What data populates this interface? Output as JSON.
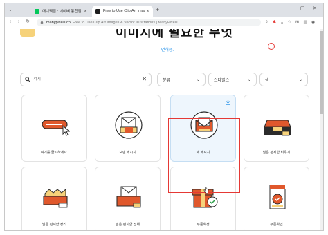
{
  "browser": {
    "tabs": [
      {
        "title": "애니팩말 : 네이버 통합검색",
        "favicon_color": "#03c75a",
        "active": false
      },
      {
        "title": "Free to Use Clip Art Images & ",
        "favicon_color": "#1d1d1d",
        "active": true
      }
    ],
    "new_tab_label": "+",
    "url_host": "manypixels.co",
    "url_rest": "Free to Use Clip Art Images & Vector Illustrations | ManyPixels"
  },
  "page": {
    "headline": "이미지에 필요한 무엇",
    "sublink": "면허증.",
    "search": {
      "placeholder": "서치",
      "value": ""
    },
    "filters": [
      {
        "label": "분류"
      },
      {
        "label": "스타일스"
      },
      {
        "label": "색"
      }
    ],
    "cards": [
      {
        "label": "여기를 클릭하세요.",
        "icon": "click-here-button-icon"
      },
      {
        "label": "보낸 메시지",
        "icon": "sent-message-icon"
      },
      {
        "label": "새 메시지",
        "icon": "new-message-icon",
        "selected": true
      },
      {
        "label": "받은 편지함 비우기",
        "icon": "empty-inbox-icon"
      },
      {
        "label": "받은 편지함 정리",
        "icon": "inbox-clean-icon"
      },
      {
        "label": "받은 편지함 전체",
        "icon": "full-inbox-icon"
      },
      {
        "label": "주문확정",
        "icon": "order-confirmed-box-icon"
      },
      {
        "label": "주문확인",
        "icon": "order-confirmed-document-icon"
      }
    ]
  },
  "colors": {
    "accent_blue": "#1f8ee8",
    "selection_red": "#e53935",
    "illustration_orange": "#e0582c",
    "illustration_yellow": "#f6d27a"
  }
}
